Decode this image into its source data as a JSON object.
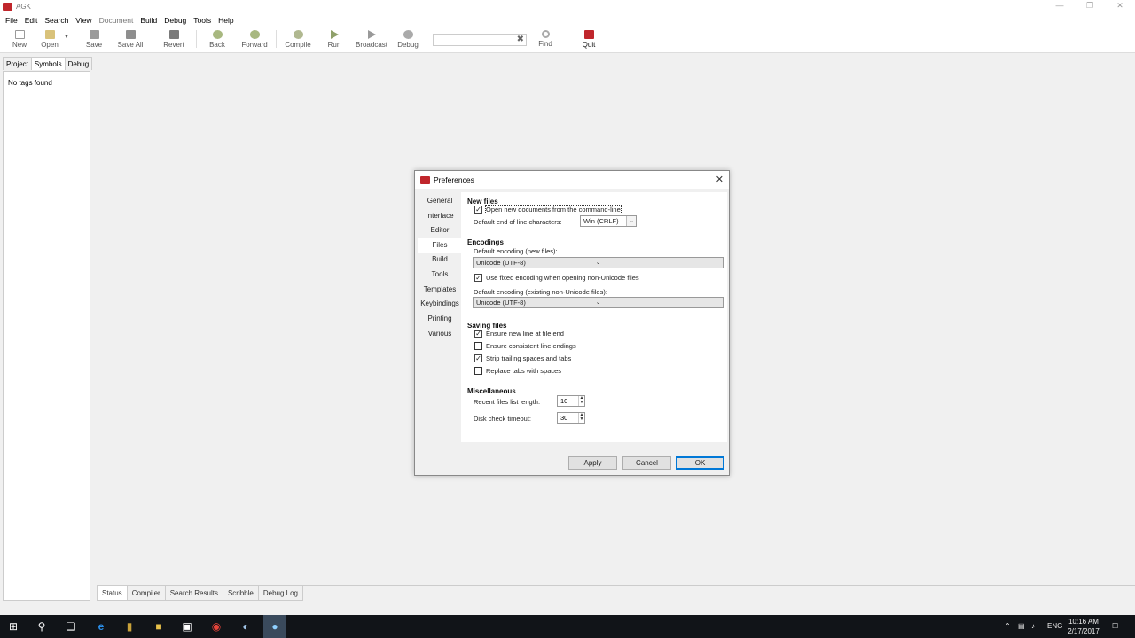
{
  "window": {
    "title": "AGK"
  },
  "menu": [
    "File",
    "Edit",
    "Search",
    "View",
    "Document",
    "Build",
    "Debug",
    "Tools",
    "Help"
  ],
  "menu_disabled": [
    false,
    false,
    false,
    false,
    true,
    false,
    false,
    false,
    false
  ],
  "toolbar": {
    "new": "New",
    "open": "Open",
    "save": "Save",
    "save_all": "Save All",
    "revert": "Revert",
    "back": "Back",
    "forward": "Forward",
    "compile": "Compile",
    "run": "Run",
    "broadcast": "Broadcast",
    "debug": "Debug",
    "find": "Find",
    "quit": "Quit",
    "search_value": ""
  },
  "sidebar": {
    "tabs": [
      "Project",
      "Symbols",
      "Debug"
    ],
    "active_tab": "Symbols",
    "message": "No tags found"
  },
  "bottom_tabs": [
    "Status",
    "Compiler",
    "Search Results",
    "Scribble",
    "Debug Log"
  ],
  "dialog": {
    "title": "Preferences",
    "nav": [
      "General",
      "Interface",
      "Editor",
      "Files",
      "Build",
      "Tools",
      "Templates",
      "Keybindings",
      "Printing",
      "Various"
    ],
    "active_nav": "Files",
    "new_files": {
      "heading": "New files",
      "open_from_cmdline": {
        "label": "Open new documents from the command-line",
        "checked": true
      },
      "eol_label": "Default end of line characters:",
      "eol_value": "Win (CRLF)"
    },
    "encodings": {
      "heading": "Encodings",
      "new_label": "Default encoding (new files):",
      "new_value": "Unicode (UTF-8)",
      "fixed": {
        "label": "Use fixed encoding when opening non-Unicode files",
        "checked": true
      },
      "existing_label": "Default encoding (existing non-Unicode files):",
      "existing_value": "Unicode (UTF-8)"
    },
    "saving": {
      "heading": "Saving files",
      "options": [
        {
          "label": "Ensure new line at file end",
          "checked": true
        },
        {
          "label": "Ensure consistent line endings",
          "checked": false
        },
        {
          "label": "Strip trailing spaces and tabs",
          "checked": true
        },
        {
          "label": "Replace tabs with spaces",
          "checked": false
        }
      ]
    },
    "misc": {
      "heading": "Miscellaneous",
      "recent_label": "Recent files list length:",
      "recent_value": "10",
      "disk_label": "Disk check timeout:",
      "disk_value": "30"
    },
    "buttons": {
      "apply": "Apply",
      "cancel": "Cancel",
      "ok": "OK"
    }
  },
  "taskbar": {
    "language": "ENG",
    "time": "10:16 AM",
    "date": "2/17/2017"
  },
  "colors": {
    "accent": "#0078d7",
    "app_icon": "#c0262c",
    "taskbar": "#111418"
  }
}
